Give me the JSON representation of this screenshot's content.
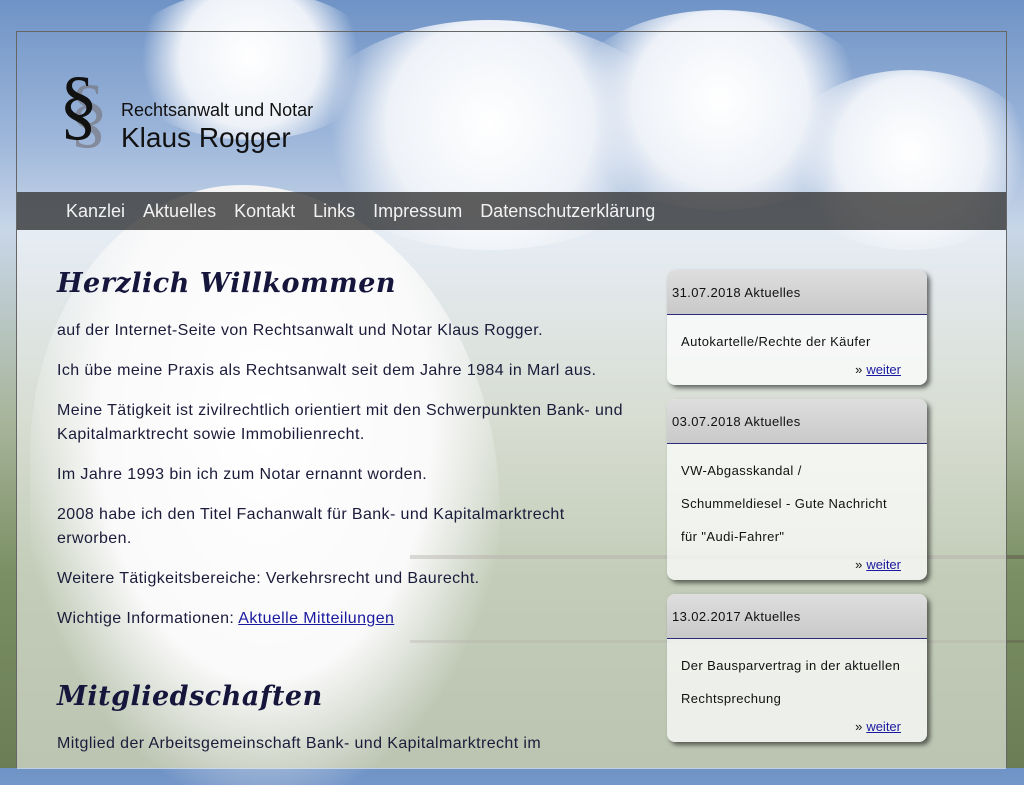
{
  "header": {
    "logo_glyph": "§",
    "tagline": "Rechtsanwalt und Notar",
    "site_name": "Klaus Rogger"
  },
  "nav": {
    "items": [
      "Kanzlei",
      "Aktuelles",
      "Kontakt",
      "Links",
      "Impressum",
      "Datenschutzerklärung"
    ]
  },
  "main": {
    "heading1": "Herzlich Willkommen",
    "p1": "auf der Internet-Seite von Rechtsanwalt und Notar Klaus Rogger.",
    "p2": "Ich übe meine Praxis als Rechtsanwalt seit dem Jahre 1984 in Marl aus.",
    "p3": "Meine Tätigkeit ist zivilrechtlich orientiert mit den Schwerpunkten Bank- und Kapitalmarktrecht sowie Immobilienrecht.",
    "p4": "Im Jahre 1993 bin ich zum Notar ernannt worden.",
    "p5": "2008 habe ich den Titel Fachanwalt für Bank- und Kapitalmarktrecht erworben.",
    "p6": "Weitere Tätigkeitsbereiche: Verkehrsrecht und Baurecht.",
    "p7_prefix": "Wichtige Informationen: ",
    "p7_link": "Aktuelle Mitteilungen",
    "heading2": "Mitgliedschaften",
    "p8": "Mitglied der Arbeitsgemeinschaft Bank- und Kapitalmarktrecht im"
  },
  "news": [
    {
      "head": "31.07.2018 Aktuelles",
      "lines": [
        "Autokartelle/Rechte der Käufer"
      ],
      "more_prefix": "»",
      "more": "weiter"
    },
    {
      "head": "03.07.2018 Aktuelles",
      "lines": [
        "VW-Abgasskandal /",
        "Schummeldiesel - Gute Nachricht",
        "für \"Audi-Fahrer\""
      ],
      "more_prefix": "»",
      "more": "weiter"
    },
    {
      "head": "13.02.2017 Aktuelles",
      "lines": [
        "Der Bausparvertrag in der aktuellen",
        "Rechtsprechung"
      ],
      "more_prefix": "»",
      "more": "weiter"
    }
  ]
}
